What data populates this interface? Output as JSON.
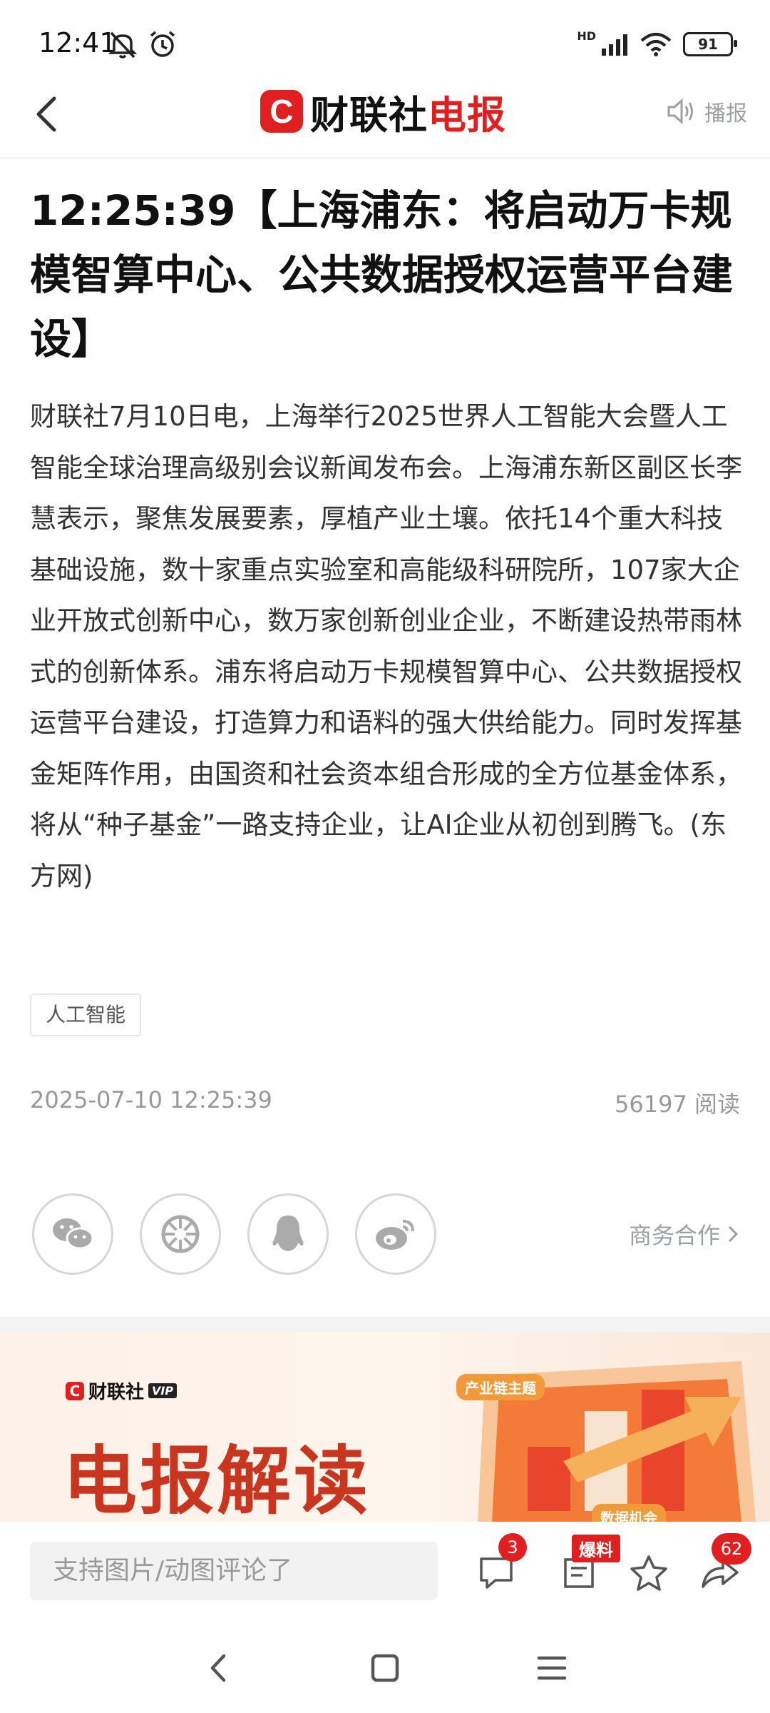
{
  "status_bar": {
    "time": "12:41",
    "network": "HD",
    "battery": "91"
  },
  "header": {
    "logo_mark": "C",
    "logo_text_black": "财联社",
    "logo_text_red": "电报",
    "broadcast_label": "播报",
    "brand_color": "#e02020"
  },
  "article": {
    "headline": "12:25:39【上海浦东：将启动万卡规模智算中心、公共数据授权运营平台建设】",
    "body": "财联社7月10日电，上海举行2025世界人工智能大会暨人工智能全球治理高级别会议新闻发布会。上海浦东新区副区长李慧表示，聚焦发展要素，厚植产业土壤。依托14个重大科技基础设施，数十家重点实验室和高能级科研院所，107家大企业开放式创新中心，数万家创新创业企业，不断建设热带雨林式的创新体系。浦东将启动万卡规模智算中心、公共数据授权运营平台建设，打造算力和语料的强大供给能力。同时发挥基金矩阵作用，由国资和社会资本组合形成的全方位基金体系，将从“种子基金”一路支持企业，让AI企业从初创到腾飞。(东方网)",
    "tag": "人工智能",
    "datetime": "2025-07-10 12:25:39",
    "reads": "56197 阅读"
  },
  "share": {
    "icons": [
      "wechat-icon",
      "moments-icon",
      "qq-icon",
      "weibo-icon"
    ],
    "business_label": "商务合作"
  },
  "banner": {
    "vip_brand": "财联社",
    "vip_badge": "VIP",
    "title": "电报解读",
    "chip_top": "产业链主题",
    "chip_bottom": "数据机会",
    "accent_color": "#c9361f"
  },
  "bottom_bar": {
    "comment_placeholder": "支持图片/动图评论了",
    "comment_count": "3",
    "tip_label": "爆料",
    "share_count": "62"
  }
}
